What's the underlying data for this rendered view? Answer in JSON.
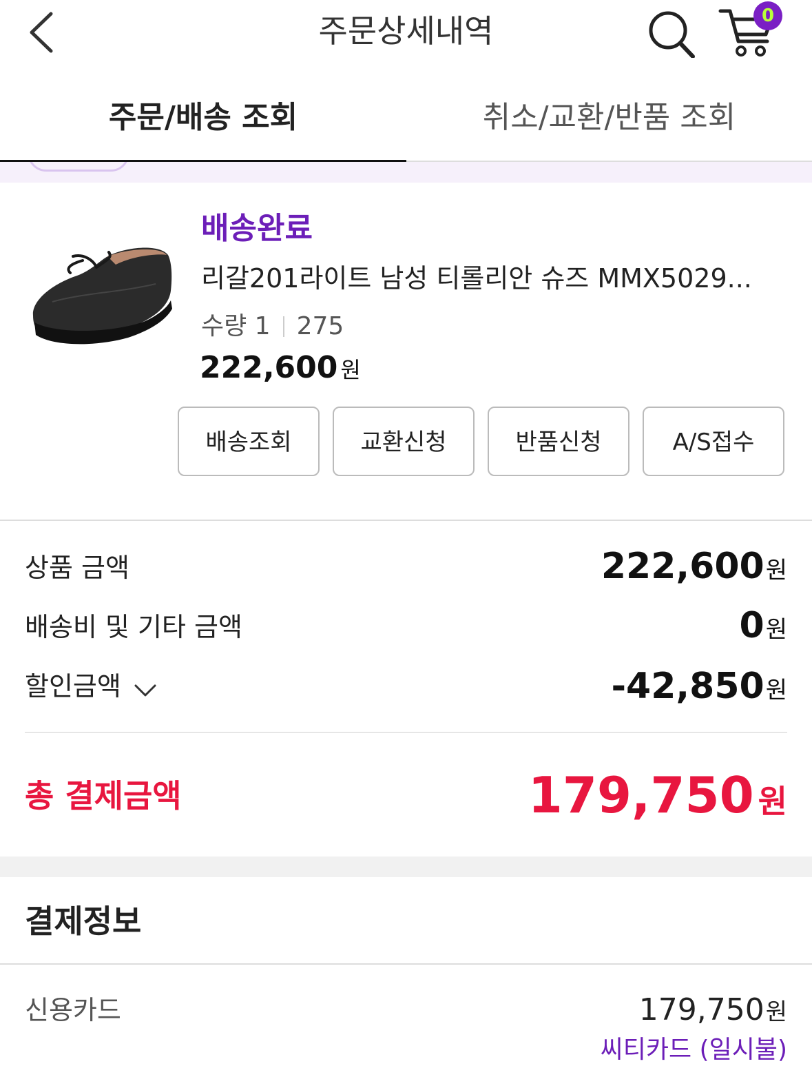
{
  "header": {
    "title": "주문상세내역",
    "cart_count": "0"
  },
  "tabs": [
    {
      "label": "주문/배송 조회",
      "active": true
    },
    {
      "label": "취소/교환/반품 조회",
      "active": false
    }
  ],
  "product": {
    "status": "배송완료",
    "name": "리갈201라이트 남성 티롤리안 슈즈 MMX5029...",
    "quantity_label": "수량 1",
    "size": "275",
    "price": "222,600",
    "price_unit": "원"
  },
  "actions": [
    "배송조회",
    "교환신청",
    "반품신청",
    "A/S접수"
  ],
  "summary": {
    "items": [
      {
        "label": "상품 금액",
        "value": "222,600",
        "unit": "원"
      },
      {
        "label": "배송비 및 기타 금액",
        "value": "0",
        "unit": "원"
      },
      {
        "label": "할인금액",
        "value": "-42,850",
        "unit": "원"
      }
    ],
    "total_label": "총 결제금액",
    "total_value": "179,750",
    "total_unit": "원"
  },
  "payment": {
    "title": "결제정보",
    "method": "신용카드",
    "amount": "179,750",
    "amount_unit": "원",
    "card": "씨티카드 (일시불)"
  },
  "colors": {
    "accent_purple": "#6c1eb8",
    "total_red": "#e8163f"
  }
}
